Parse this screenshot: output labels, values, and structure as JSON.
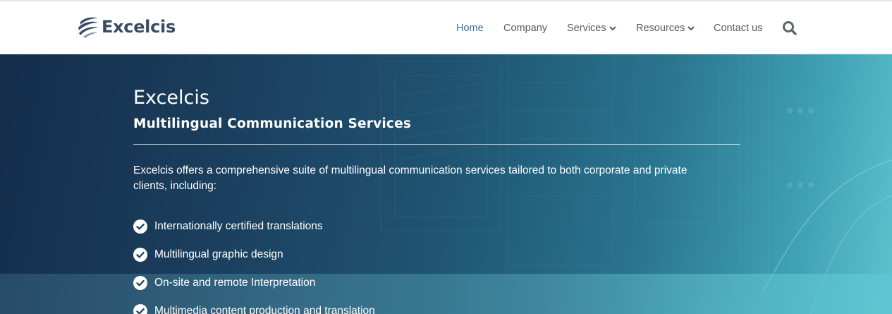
{
  "brand": {
    "name": "Excelcis",
    "logo_icon": "swoosh-globe-logo-icon"
  },
  "nav": {
    "items": [
      {
        "label": "Home",
        "active": true,
        "has_dropdown": false
      },
      {
        "label": "Company",
        "active": false,
        "has_dropdown": false
      },
      {
        "label": "Services",
        "active": false,
        "has_dropdown": true
      },
      {
        "label": "Resources",
        "active": false,
        "has_dropdown": true
      },
      {
        "label": "Contact us",
        "active": false,
        "has_dropdown": false
      }
    ],
    "search_icon": "search-icon"
  },
  "hero": {
    "title": "Excelcis",
    "subtitle": "Multilingual Communication Services",
    "intro": "Excelcis offers a comprehensive suite of multilingual communication services tailored to both corporate and private clients, including:",
    "services": [
      "Internationally certified translations",
      "Multilingual graphic design",
      "On-site and remote Interpretation",
      "Multimedia content production and translation"
    ]
  },
  "colors": {
    "accent_nav_active": "#3b6fa0",
    "nav_text": "#555b63",
    "logo_text": "#3a4a63",
    "hero_dark": "#142d4b",
    "hero_light": "#5ec3cf"
  }
}
